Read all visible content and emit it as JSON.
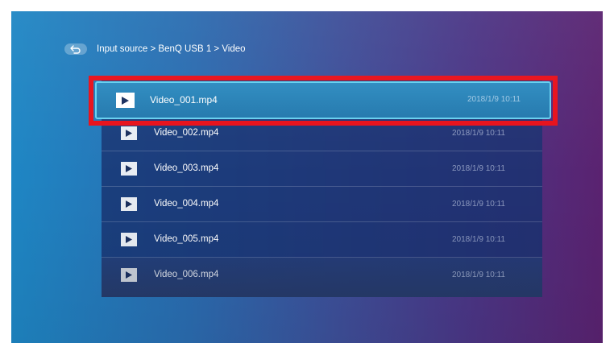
{
  "header": {
    "breadcrumb": "Input source > BenQ USB 1 > Video",
    "back_icon": "back-arrow-icon"
  },
  "files": [
    {
      "name": "Video_001.mp4",
      "date": "2018/1/9 10:11",
      "icon": "play-icon",
      "selected": true
    },
    {
      "name": "Video_002.mp4",
      "date": "2018/1/9 10:11",
      "icon": "play-icon"
    },
    {
      "name": "Video_003.mp4",
      "date": "2018/1/9 10:11",
      "icon": "play-icon"
    },
    {
      "name": "Video_004.mp4",
      "date": "2018/1/9 10:11",
      "icon": "play-icon"
    },
    {
      "name": "Video_005.mp4",
      "date": "2018/1/9 10:11",
      "icon": "play-icon"
    },
    {
      "name": "Video_006.mp4",
      "date": "2018/1/9 10:11",
      "icon": "play-icon"
    }
  ],
  "colors": {
    "highlight_outline": "#e8101a",
    "selected_border": "#66d0f0",
    "selected_fill": "#2884b8",
    "list_background": "#183270"
  }
}
